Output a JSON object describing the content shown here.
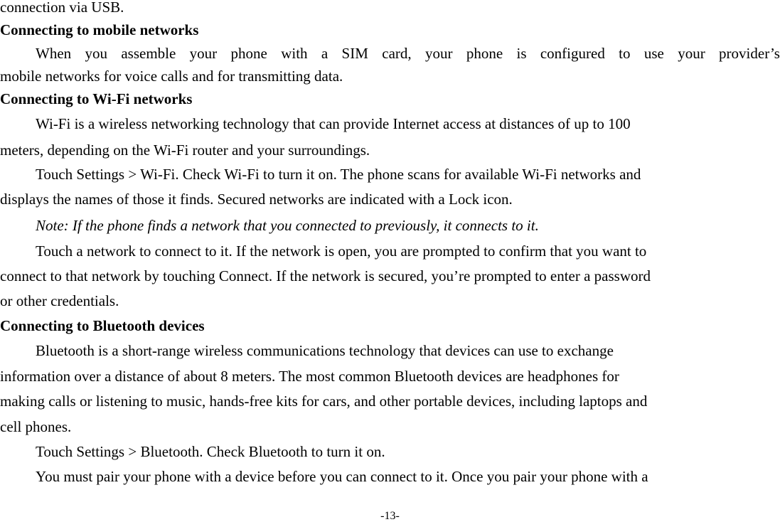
{
  "page": {
    "number": "-13-",
    "lines": {
      "l01": "connection via USB.",
      "h_mobile": "Connecting to mobile networks",
      "l03_words": [
        "When",
        "you",
        "assemble",
        "your",
        "phone",
        "with",
        "a",
        "SIM",
        "card,",
        "your",
        "phone",
        "is",
        "configured",
        "to",
        "use",
        "your",
        "provider’s"
      ],
      "l04": "mobile networks for voice calls and for transmitting data.",
      "h_wifi": "Connecting to Wi-Fi networks",
      "l06": "Wi-Fi is a wireless networking technology that can provide Internet access at distances of up to 100",
      "l07": "meters, depending on the Wi-Fi router and your surroundings.",
      "l08": "Touch Settings > Wi-Fi. Check Wi-Fi to turn it on. The phone scans for available Wi-Fi networks and",
      "l09": "displays the names of those it finds. Secured networks are indicated with a Lock icon.",
      "l10": "Note: If the phone finds a network that you connected to previously, it connects to it.",
      "l11": "Touch a network to connect to it. If the network is open, you are prompted to confirm that you want to",
      "l12": "connect to that network by touching Connect. If the network is secured, you’re prompted to enter a password",
      "l13": "or other credentials.",
      "h_bt": "Connecting to Bluetooth devices",
      "l15": "Bluetooth is a short-range wireless communications technology that devices can use to exchange",
      "l16": "information over a distance of about 8 meters. The most common Bluetooth devices are headphones for",
      "l17": "making calls or listening to music, hands-free kits for cars, and other portable devices, including laptops and",
      "l18": "cell phones.",
      "l19": "Touch Settings > Bluetooth. Check Bluetooth to turn it on.",
      "l20": "You must pair your phone with a device before you can connect to it. Once you pair your phone with a"
    }
  }
}
